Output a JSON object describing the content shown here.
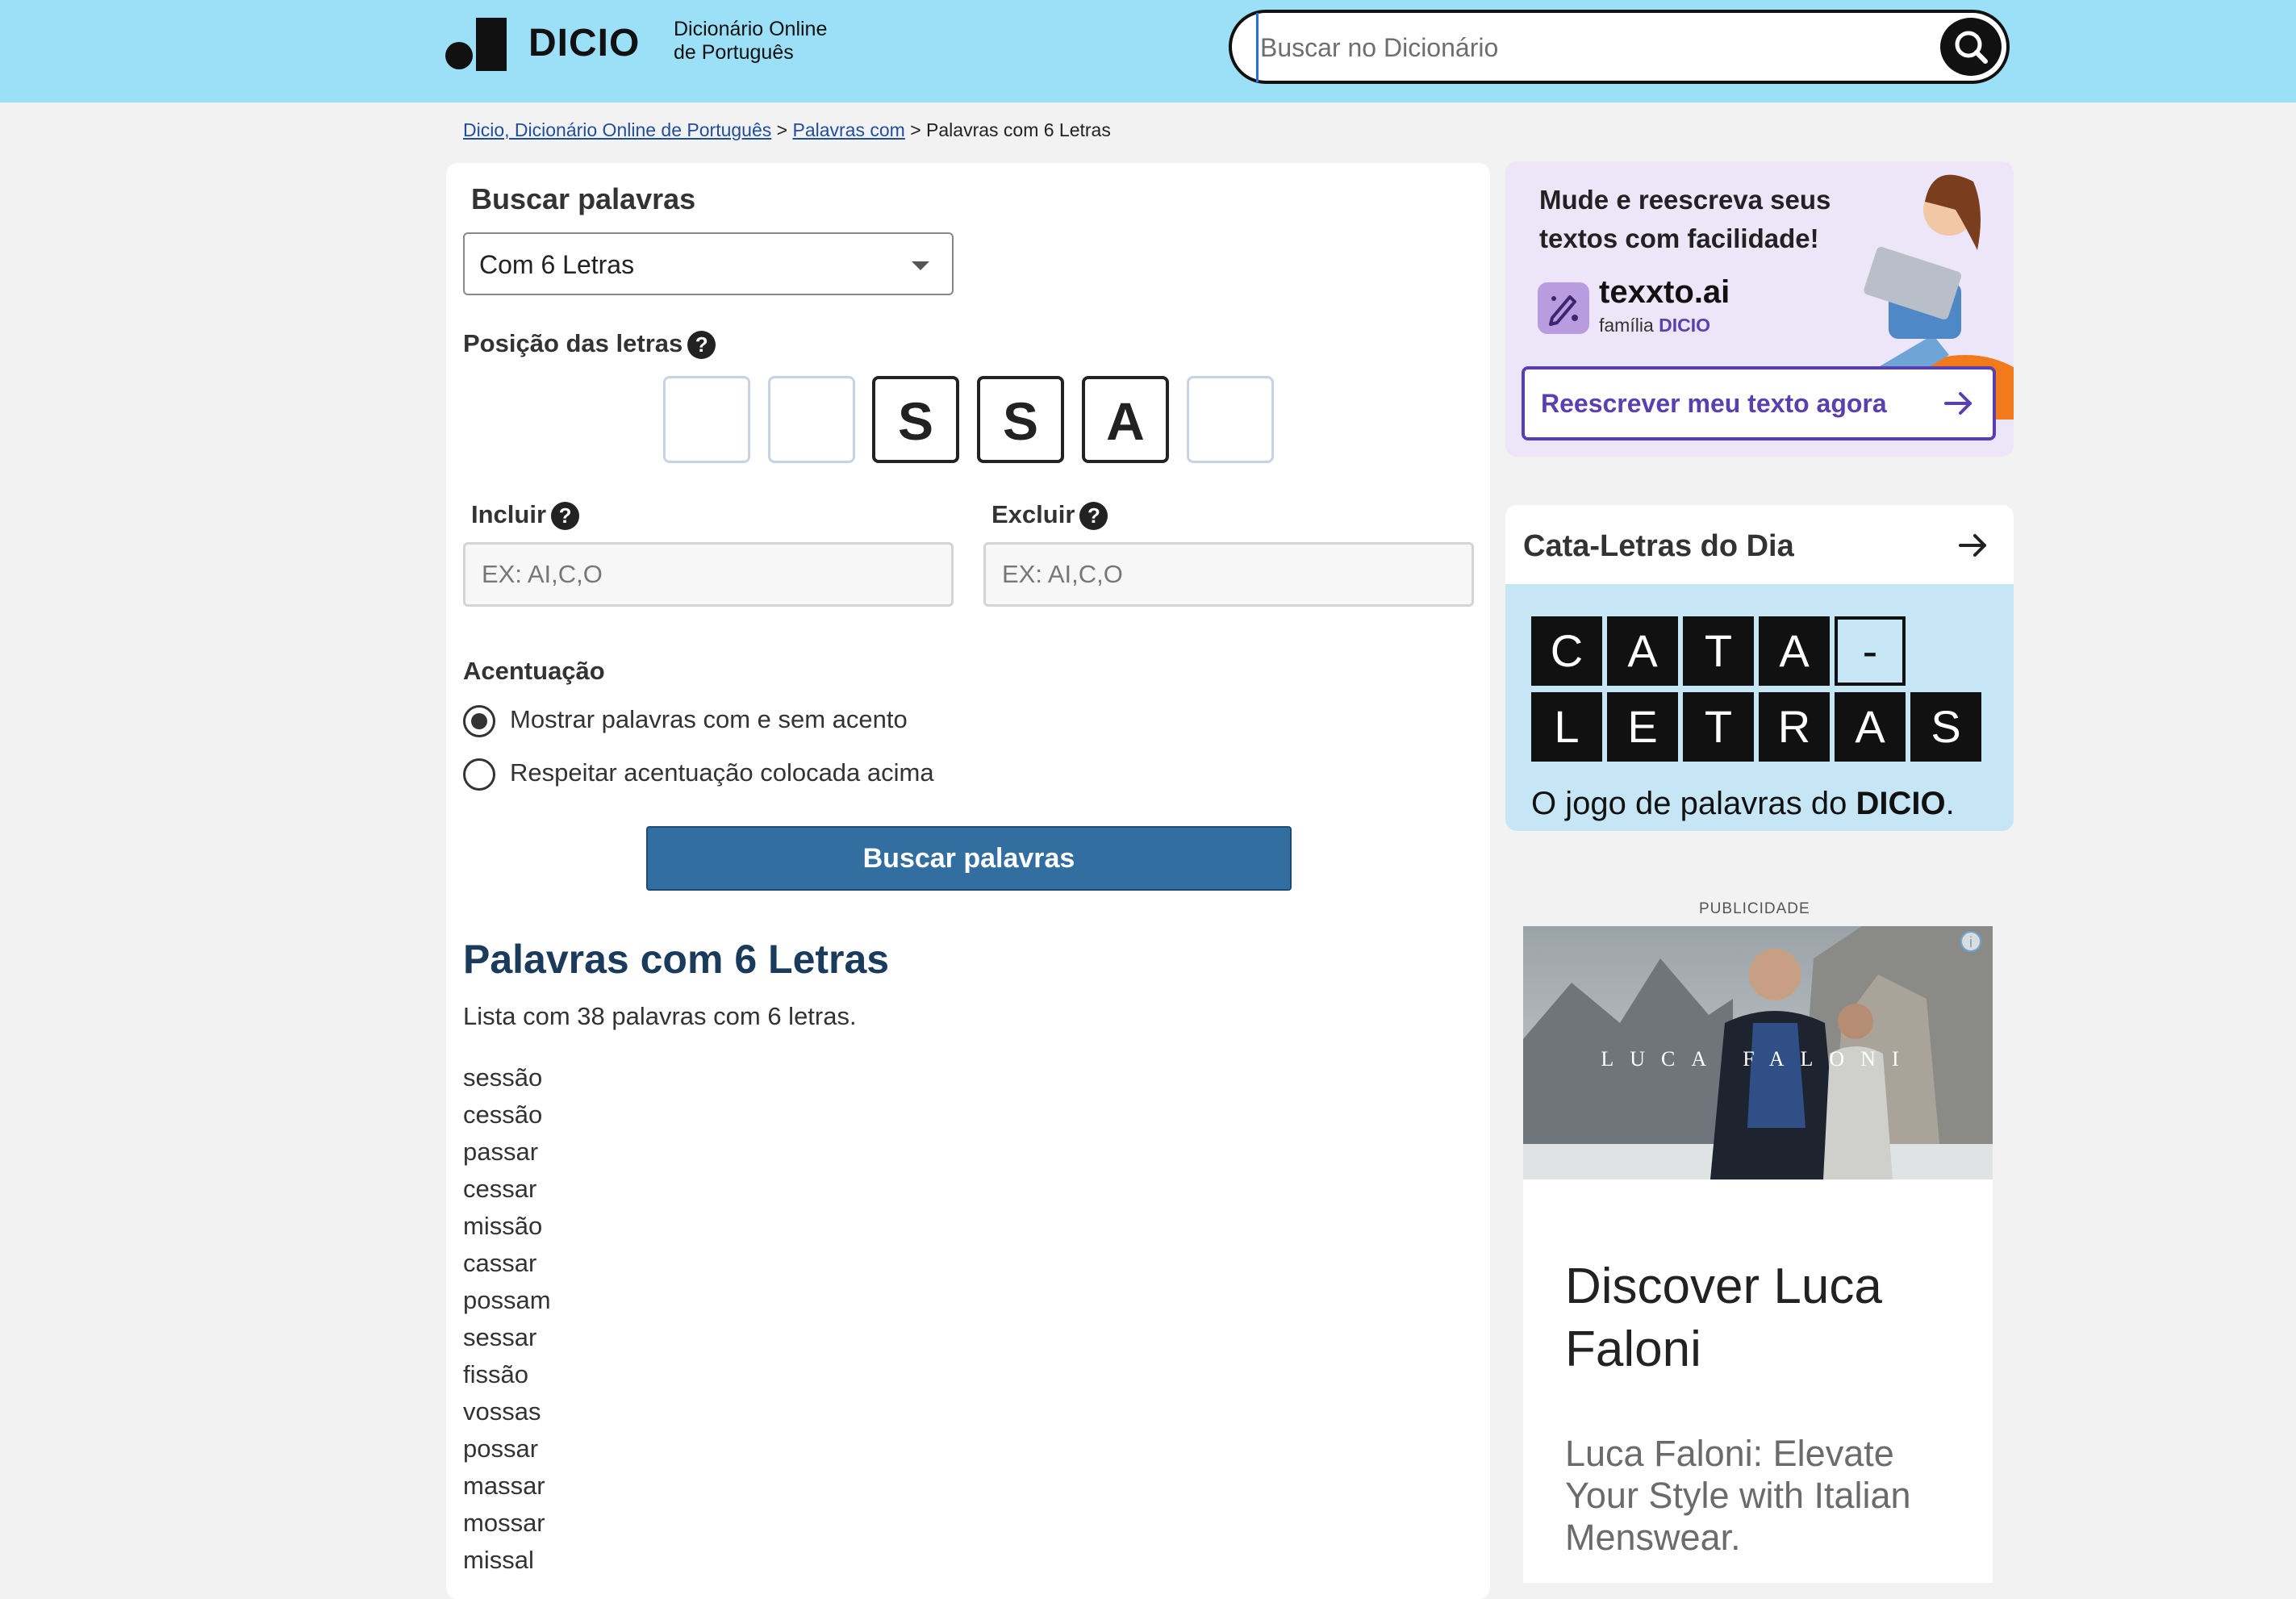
{
  "header": {
    "logo_text": "DICIO",
    "logo_sub_line1": "Dicionário Online",
    "logo_sub_line2": "de Português",
    "search_placeholder": "Buscar no Dicionário",
    "search_icon": "search-icon"
  },
  "breadcrumb": {
    "home": "Dicio, Dicionário Online de Português",
    "sep1": " > ",
    "section": "Palavras com",
    "sep2": " > ",
    "current": "Palavras com 6 Letras"
  },
  "form": {
    "title": "Buscar palavras",
    "select_value": "Com 6 Letras",
    "position_label": "Posição das letras",
    "help_glyph": "?",
    "letters": [
      "",
      "",
      "S",
      "S",
      "A",
      ""
    ],
    "include_label": "Incluir",
    "include_placeholder": "EX: AI,C,O",
    "exclude_label": "Excluir",
    "exclude_placeholder": "EX: AI,C,O",
    "accent_label": "Acentuação",
    "radio_options": [
      "Mostrar palavras com e sem acento",
      "Respeitar acentuação colocada acima"
    ],
    "radio_selected_index": 0,
    "submit_label": "Buscar palavras"
  },
  "results": {
    "title": "Palavras com 6 Letras",
    "description": "Lista com 38 palavras com 6 letras.",
    "words": [
      "sessão",
      "cessão",
      "passar",
      "cessar",
      "missão",
      "cassar",
      "possam",
      "sessar",
      "fissão",
      "vossas",
      "possar",
      "massar",
      "mossar",
      "missal"
    ]
  },
  "texxto_promo": {
    "title": "Mude e reescreva seus textos com facilidade!",
    "brand": "texxto.ai",
    "family_prefix": "família ",
    "family_brand": "DICIO",
    "cta": "Reescrever meu texto agora",
    "accent_color": "#5a3fb0"
  },
  "cata_letras": {
    "title": "Cata-Letras do Dia",
    "row1": [
      "C",
      "A",
      "T",
      "A",
      "-"
    ],
    "row2": [
      "L",
      "E",
      "T",
      "R",
      "A",
      "S"
    ],
    "caption_prefix": "O jogo de palavras do ",
    "caption_brand": "DICIO",
    "caption_suffix": "."
  },
  "ad": {
    "label": "PUBLICIDADE",
    "image_brand": "LUCA FALONI",
    "headline": "Discover Luca Faloni",
    "description": "Luca Faloni: Elevate Your Style with Italian Menswear.",
    "info_glyph": "i"
  },
  "colors": {
    "header_bg": "#9be0f7",
    "primary_button": "#336ea1",
    "result_title": "#1a3b5c",
    "cata_bg": "#c6e6f6"
  }
}
